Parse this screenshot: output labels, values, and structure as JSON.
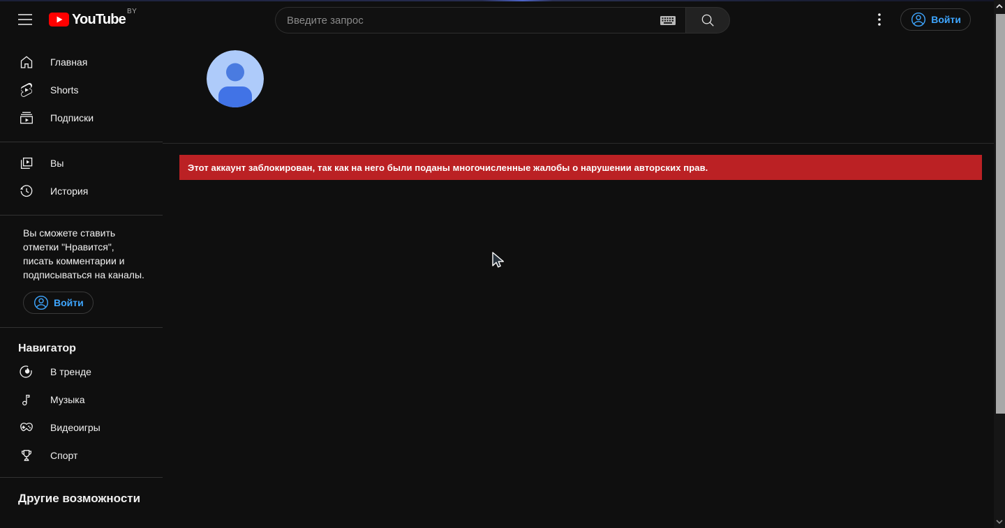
{
  "header": {
    "logo_text": "YouTube",
    "country_code": "BY",
    "search": {
      "placeholder": "Введите запрос",
      "value": ""
    },
    "signin_label": "Войти"
  },
  "sidebar": {
    "main_items": [
      {
        "icon": "home-icon",
        "label": "Главная"
      },
      {
        "icon": "shorts-icon",
        "label": "Shorts"
      },
      {
        "icon": "subscriptions-icon",
        "label": "Подписки"
      }
    ],
    "you_items": [
      {
        "icon": "you-icon",
        "label": "Вы"
      },
      {
        "icon": "history-icon",
        "label": "История"
      }
    ],
    "promo_text": "Вы сможете ставить отметки \"Нравится\", писать комментарии и подписываться на каналы.",
    "promo_signin_label": "Войти",
    "explore": {
      "title": "Навигатор",
      "items": [
        {
          "icon": "trending-icon",
          "label": "В тренде"
        },
        {
          "icon": "music-icon",
          "label": "Музыка"
        },
        {
          "icon": "gaming-icon",
          "label": "Видеоигры"
        },
        {
          "icon": "sports-icon",
          "label": "Спорт"
        }
      ]
    },
    "more_title": "Другие возможности"
  },
  "main": {
    "banner_text": "Этот аккаунт заблокирован, так как на него были поданы многочисленные жалобы о нарушении авторских прав."
  },
  "colors": {
    "background": "#0f0f0f",
    "accent_blue": "#3ea6ff",
    "banner_red": "#bb2124",
    "logo_red": "#ff0000",
    "avatar_bg": "#aecbfa",
    "avatar_person": "#4a7be0",
    "scrollbar_thumb": "#a8a8a8"
  }
}
